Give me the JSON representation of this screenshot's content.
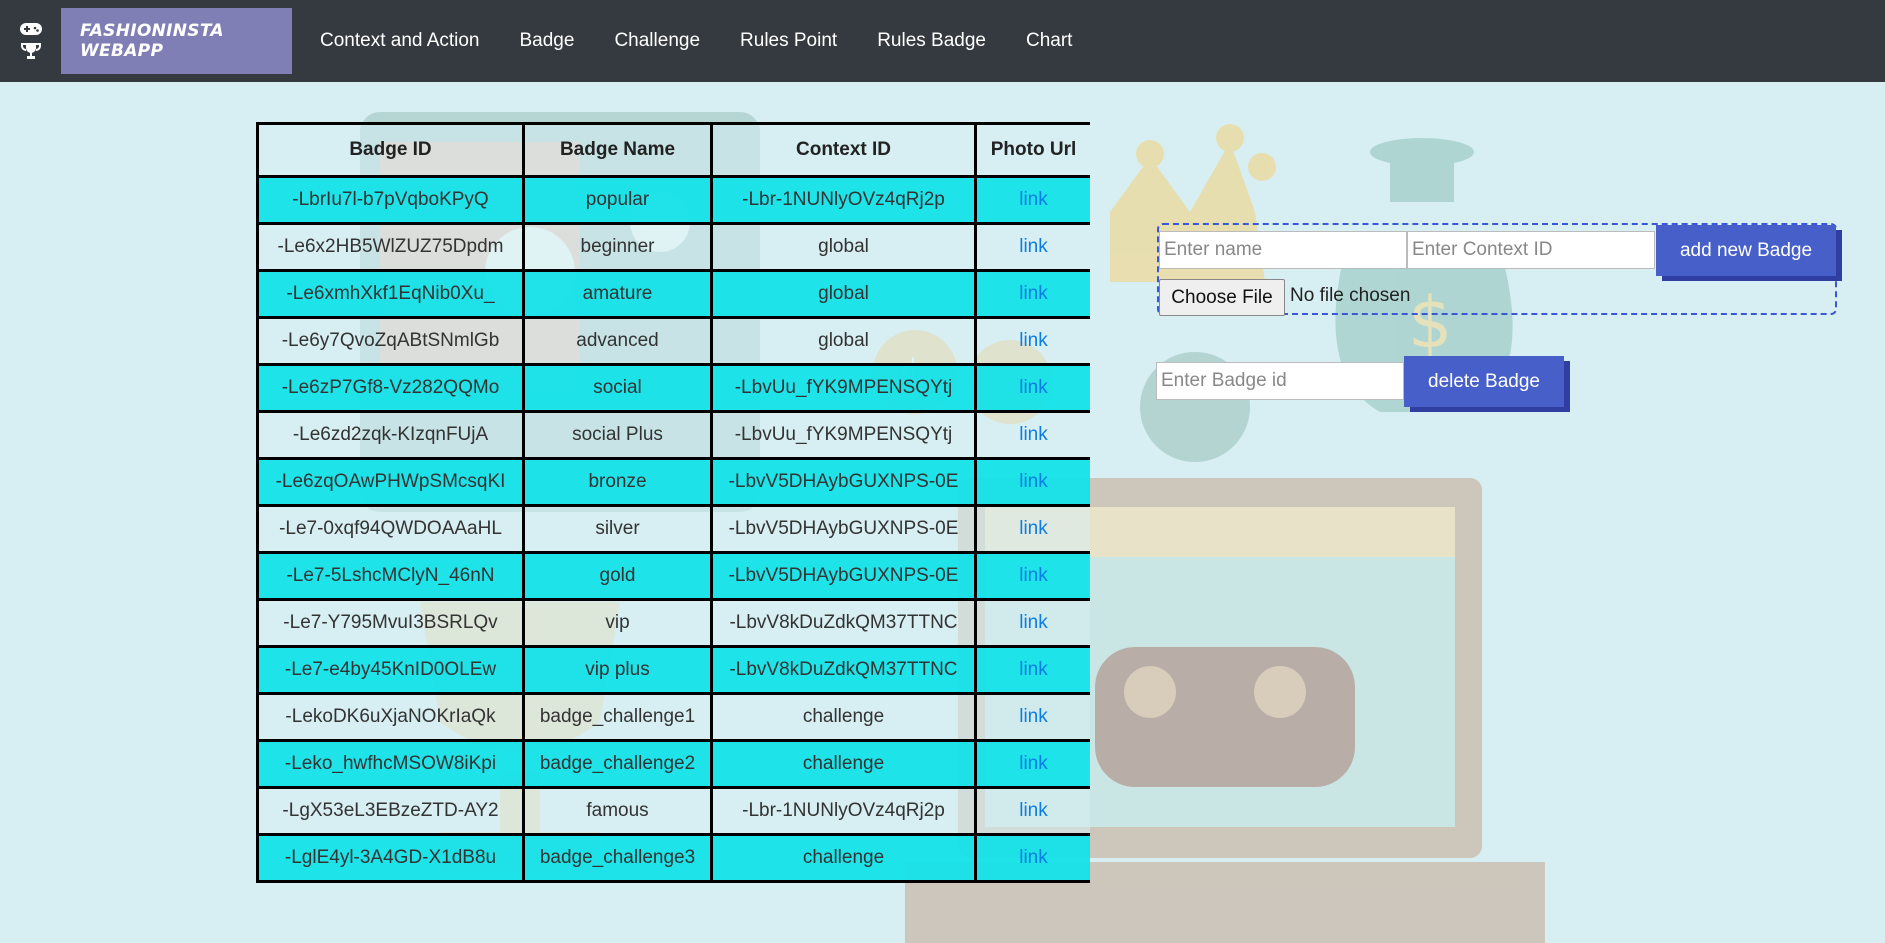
{
  "nav": {
    "icons": [
      "gamepad-icon",
      "trophy-icon"
    ],
    "brand": "FASHIONINSTA WEBAPP",
    "links": [
      "Context and Action",
      "Badge",
      "Challenge",
      "Rules Point",
      "Rules Badge",
      "Chart"
    ]
  },
  "table": {
    "headers": [
      "Badge ID",
      "Badge Name",
      "Context ID",
      "Photo Url"
    ],
    "rows": [
      {
        "id": "-LbrIu7l-b7pVqboKPyQ",
        "name": "popular",
        "context": "-Lbr-1NUNlyOVz4qRj2p",
        "photo": "link"
      },
      {
        "id": "-Le6x2HB5WlZUZ75Dpdm",
        "name": "beginner",
        "context": "global",
        "photo": "link"
      },
      {
        "id": "-Le6xmhXkf1EqNib0Xu_",
        "name": "amature",
        "context": "global",
        "photo": "link"
      },
      {
        "id": "-Le6y7QvoZqABtSNmlGb",
        "name": "advanced",
        "context": "global",
        "photo": "link"
      },
      {
        "id": "-Le6zP7Gf8-Vz282QQMo",
        "name": "social",
        "context": "-LbvUu_fYK9MPENSQYtj",
        "photo": "link"
      },
      {
        "id": "-Le6zd2zqk-KIzqnFUjA",
        "name": "social Plus",
        "context": "-LbvUu_fYK9MPENSQYtj",
        "photo": "link"
      },
      {
        "id": "-Le6zqOAwPHWpSMcsqKI",
        "name": "bronze",
        "context": "-LbvV5DHAybGUXNPS-0E",
        "photo": "link"
      },
      {
        "id": "-Le7-0xqf94QWDOAAaHL",
        "name": "silver",
        "context": "-LbvV5DHAybGUXNPS-0E",
        "photo": "link"
      },
      {
        "id": "-Le7-5LshcMClyN_46nN",
        "name": "gold",
        "context": "-LbvV5DHAybGUXNPS-0E",
        "photo": "link"
      },
      {
        "id": "-Le7-Y795MvuI3BSRLQv",
        "name": "vip",
        "context": "-LbvV8kDuZdkQM37TTNC",
        "photo": "link"
      },
      {
        "id": "-Le7-e4by45KnID0OLEw",
        "name": "vip plus",
        "context": "-LbvV8kDuZdkQM37TTNC",
        "photo": "link"
      },
      {
        "id": "-LekoDK6uXjaNOKrIaQk",
        "name": "badge_challenge1",
        "context": "challenge",
        "photo": "link"
      },
      {
        "id": "-Leko_hwfhcMSOW8iKpi",
        "name": "badge_challenge2",
        "context": "challenge",
        "photo": "link"
      },
      {
        "id": "-LgX53eL3EBzeZTD-AY2",
        "name": "famous",
        "context": "-Lbr-1NUNlyOVz4qRj2p",
        "photo": "link"
      },
      {
        "id": "-LglE4yl-3A4GD-X1dB8u",
        "name": "badge_challenge3",
        "context": "challenge",
        "photo": "link"
      }
    ]
  },
  "add_form": {
    "name_placeholder": "Enter name",
    "context_placeholder": "Enter Context ID",
    "submit_label": "add new Badge",
    "file_button_label": "Choose File",
    "file_status": "No file chosen"
  },
  "delete_form": {
    "id_placeholder": "Enter Badge id",
    "submit_label": "delete Badge"
  },
  "colors": {
    "navbar": "#343a40",
    "brand_bg": "#7f7fb5",
    "background": "#d7eef2",
    "row_highlight": "#18e2e8",
    "button": "#4760c9",
    "link": "#0b7de3"
  }
}
